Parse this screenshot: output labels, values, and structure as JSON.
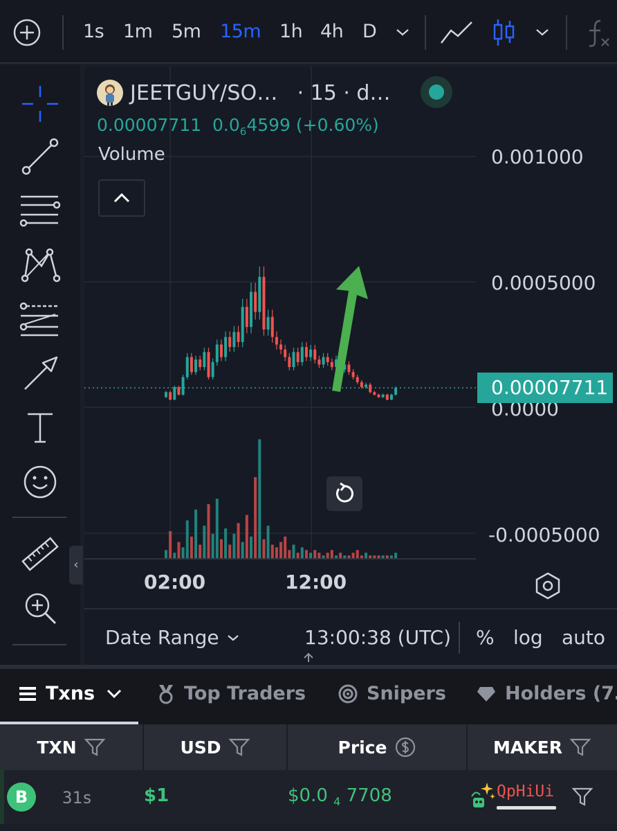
{
  "toolbar": {
    "timeframes": [
      {
        "label": "1s",
        "active": false
      },
      {
        "label": "1m",
        "active": false
      },
      {
        "label": "5m",
        "active": false
      },
      {
        "label": "15m",
        "active": true
      },
      {
        "label": "1h",
        "active": false
      },
      {
        "label": "4h",
        "active": false
      },
      {
        "label": "D",
        "active": false
      }
    ],
    "icons": [
      "add-circle-icon",
      "chevron-down-icon",
      "line-chart-icon",
      "candlestick-icon",
      "chevron-down-icon",
      "function-icon"
    ]
  },
  "left_tools": [
    "crosshair-icon",
    "trend-line-icon",
    "horizontal-lines-icon",
    "pattern-icon",
    "fib-levels-icon",
    "arrow-icon",
    "text-icon",
    "emoji-icon",
    "ruler-icon",
    "zoom-in-icon"
  ],
  "legend": {
    "symbol": "JEETGUY/SO…",
    "interval": "· 15 · d…",
    "last_price": "0.00007711",
    "change_prefix": "0.0",
    "change_zeros": "6",
    "change_rest": "4599 (+0.60%)",
    "volume_label": "Volume"
  },
  "chart_data": {
    "type": "candlestick",
    "price_axis_labels": [
      "0.001000",
      "0.0005000",
      "0.0000",
      "-0.0005000"
    ],
    "time_axis_labels": [
      "02:00",
      "12:00"
    ],
    "current_price_tag": "0.00007711",
    "annotation": "green-up-arrow",
    "colors": {
      "up": "#26a69a",
      "down": "#ef5350",
      "arrow": "#4caf50"
    }
  },
  "footer": {
    "date_range": "Date Range",
    "clock": "13:00:38 (UTC)",
    "percent": "%",
    "log": "log",
    "auto": "auto"
  },
  "tabs": [
    {
      "label": "Txns",
      "active": true
    },
    {
      "label": "Top Traders",
      "active": false
    },
    {
      "label": "Snipers",
      "active": false
    },
    {
      "label": "Holders (7…",
      "active": false
    }
  ],
  "table": {
    "headers": [
      "TXN",
      "USD",
      "Price",
      "MAKER"
    ],
    "row": {
      "type": "B",
      "age": "31s",
      "usd": "$1",
      "price_prefix": "$0.0",
      "price_zeros": "4",
      "price_rest": "7708",
      "maker": "QpHiUi"
    }
  },
  "colors": {
    "accent": "#2962ff",
    "up": "#26a69a",
    "down": "#ef5350",
    "buy": "#3ec27a",
    "background": "#161a24"
  }
}
